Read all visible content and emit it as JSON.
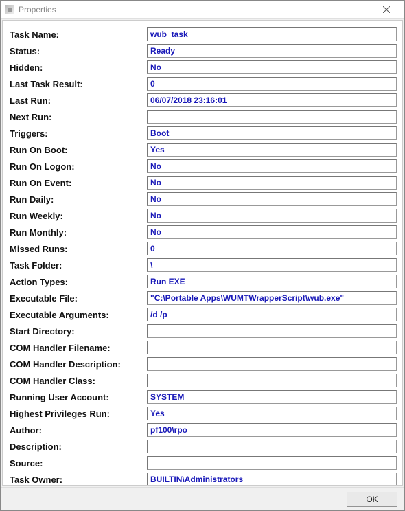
{
  "window": {
    "title": "Properties",
    "ok_label": "OK"
  },
  "fields": [
    {
      "label": "Task Name:",
      "value": "wub_task"
    },
    {
      "label": "Status:",
      "value": "Ready"
    },
    {
      "label": "Hidden:",
      "value": "No"
    },
    {
      "label": "Last Task Result:",
      "value": "0"
    },
    {
      "label": "Last Run:",
      "value": "06/07/2018 23:16:01"
    },
    {
      "label": "Next Run:",
      "value": ""
    },
    {
      "label": "Triggers:",
      "value": "Boot"
    },
    {
      "label": "Run On Boot:",
      "value": "Yes"
    },
    {
      "label": "Run On Logon:",
      "value": "No"
    },
    {
      "label": "Run On Event:",
      "value": "No"
    },
    {
      "label": "Run Daily:",
      "value": "No"
    },
    {
      "label": "Run Weekly:",
      "value": "No"
    },
    {
      "label": "Run Monthly:",
      "value": "No"
    },
    {
      "label": "Missed Runs:",
      "value": "0"
    },
    {
      "label": "Task Folder:",
      "value": "\\"
    },
    {
      "label": "Action Types:",
      "value": "Run EXE"
    },
    {
      "label": "Executable File:",
      "value": "\"C:\\Portable Apps\\WUMTWrapperScript\\wub.exe\""
    },
    {
      "label": "Executable Arguments:",
      "value": "/d /p"
    },
    {
      "label": "Start Directory:",
      "value": ""
    },
    {
      "label": "COM Handler Filename:",
      "value": ""
    },
    {
      "label": "COM Handler Description:",
      "value": ""
    },
    {
      "label": "COM Handler Class:",
      "value": ""
    },
    {
      "label": "Running User Account:",
      "value": "SYSTEM"
    },
    {
      "label": "Highest Privileges Run:",
      "value": "Yes"
    },
    {
      "label": "Author:",
      "value": "pf100\\rpo"
    },
    {
      "label": "Description:",
      "value": ""
    },
    {
      "label": "Source:",
      "value": ""
    },
    {
      "label": "Task Owner:",
      "value": "BUILTIN\\Administrators"
    }
  ]
}
